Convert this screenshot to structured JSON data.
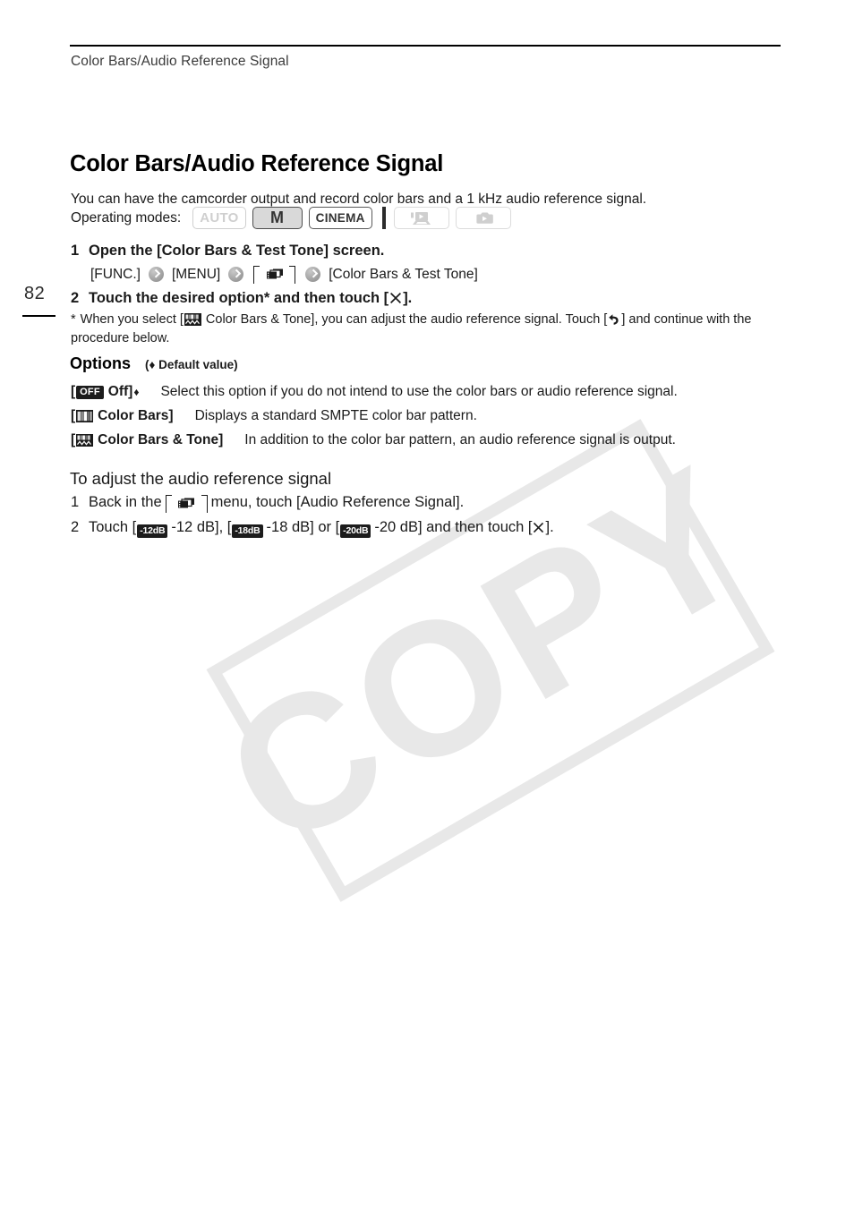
{
  "running_head": "Color Bars/Audio Reference Signal",
  "page_number": "82",
  "title": "Color Bars/Audio Reference Signal",
  "intro": "You can have the camcorder output and record color bars and a 1 kHz audio reference signal.",
  "operating_modes": {
    "label": "Operating modes:",
    "badges": [
      {
        "name": "auto-mode-badge",
        "text": "AUTO",
        "state": "disabled"
      },
      {
        "name": "manual-mode-badge",
        "text": "M",
        "state": "active"
      },
      {
        "name": "cinema-mode-badge",
        "text": "CINEMA",
        "state": "enabled"
      },
      {
        "name": "movie-playback-mode-badge",
        "text": "",
        "icon": "movie-playback-icon",
        "state": "disabled"
      },
      {
        "name": "photo-playback-mode-badge",
        "text": "",
        "icon": "photo-playback-icon",
        "state": "disabled"
      }
    ]
  },
  "steps": [
    {
      "num": "1",
      "text": "Open the [Color Bars & Test Tone] screen."
    },
    {
      "num": "2",
      "text_before": "Touch the desired option* and then touch [",
      "text_after": "]."
    }
  ],
  "nav_path": {
    "func": "[FUNC.]",
    "menu": "[MENU]",
    "tab_icon": "recording-setup-tab-icon",
    "target": "[Color Bars & Test Tone]"
  },
  "footnote": {
    "mark": "*",
    "part1": "When you select [",
    "icon": "color-bars-tone-icon",
    "part2": "Color Bars & Tone], you can adjust the audio reference signal. Touch [",
    "back_icon": "back-arrow-icon",
    "part3": "] and continue with the procedure below."
  },
  "options": {
    "heading": "Options",
    "default_note": "(♦ Default value)",
    "items": [
      {
        "name": "option-off",
        "icon": "off-badge-icon",
        "icon_text": "OFF",
        "key": "Off]",
        "bracket_open": "[",
        "default_marker": "♦",
        "description": "Select this option if you do not intend to use the color bars or audio reference signal."
      },
      {
        "name": "option-color-bars",
        "icon": "color-bars-icon",
        "icon_text": "",
        "key": "Color Bars]",
        "bracket_open": "[",
        "default_marker": "",
        "description": "Displays a standard SMPTE color bar pattern."
      },
      {
        "name": "option-color-bars-tone",
        "icon": "color-bars-tone-icon",
        "icon_text": "",
        "key": "Color Bars & Tone]",
        "bracket_open": "[",
        "default_marker": "",
        "description": "In addition to the color bar pattern, an audio reference signal is output."
      }
    ]
  },
  "adjust_section": {
    "heading": "To adjust the audio reference signal",
    "step1": {
      "num": "1",
      "part1": "Back in the",
      "icon": "recording-setup-tab-icon",
      "part2": "menu, touch [Audio Reference Signal]."
    },
    "step2": {
      "num": "2",
      "part1": "Touch [",
      "badge1": "-12dB",
      "part2": "-12 dB], [",
      "badge2": "-18dB",
      "part3": "-18 dB] or [",
      "badge3": "-20dB",
      "part4": "-20 dB] and then touch [",
      "part5": "]."
    }
  },
  "watermark": {
    "text": "COPY"
  },
  "colors": {
    "text": "#1a1a1a",
    "rule": "#000000",
    "badge_dark": "#1c1c1c",
    "badge_disabled": "#cfcfcf",
    "watermark": "#e8e8e8"
  }
}
